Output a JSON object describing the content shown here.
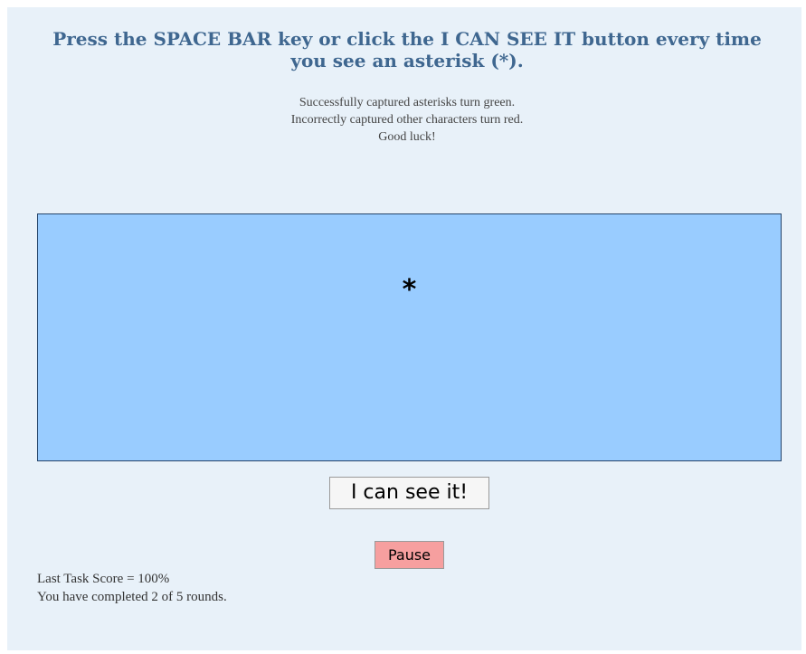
{
  "instruction": "Press the SPACE BAR key or click the I CAN SEE IT button every time you see an asterisk (*).",
  "rules": [
    "Successfully captured asterisks turn green.",
    "Incorrectly captured other characters turn red.",
    "Good luck!"
  ],
  "stimulus": {
    "character": "*",
    "box_color": "#99ccff"
  },
  "buttons": {
    "see_label": "I can see it!",
    "pause_label": "Pause",
    "pause_color": "#f69f9f"
  },
  "status": {
    "last_score": "Last Task Score = 100%",
    "progress": "You have completed 2 of 5 rounds."
  }
}
